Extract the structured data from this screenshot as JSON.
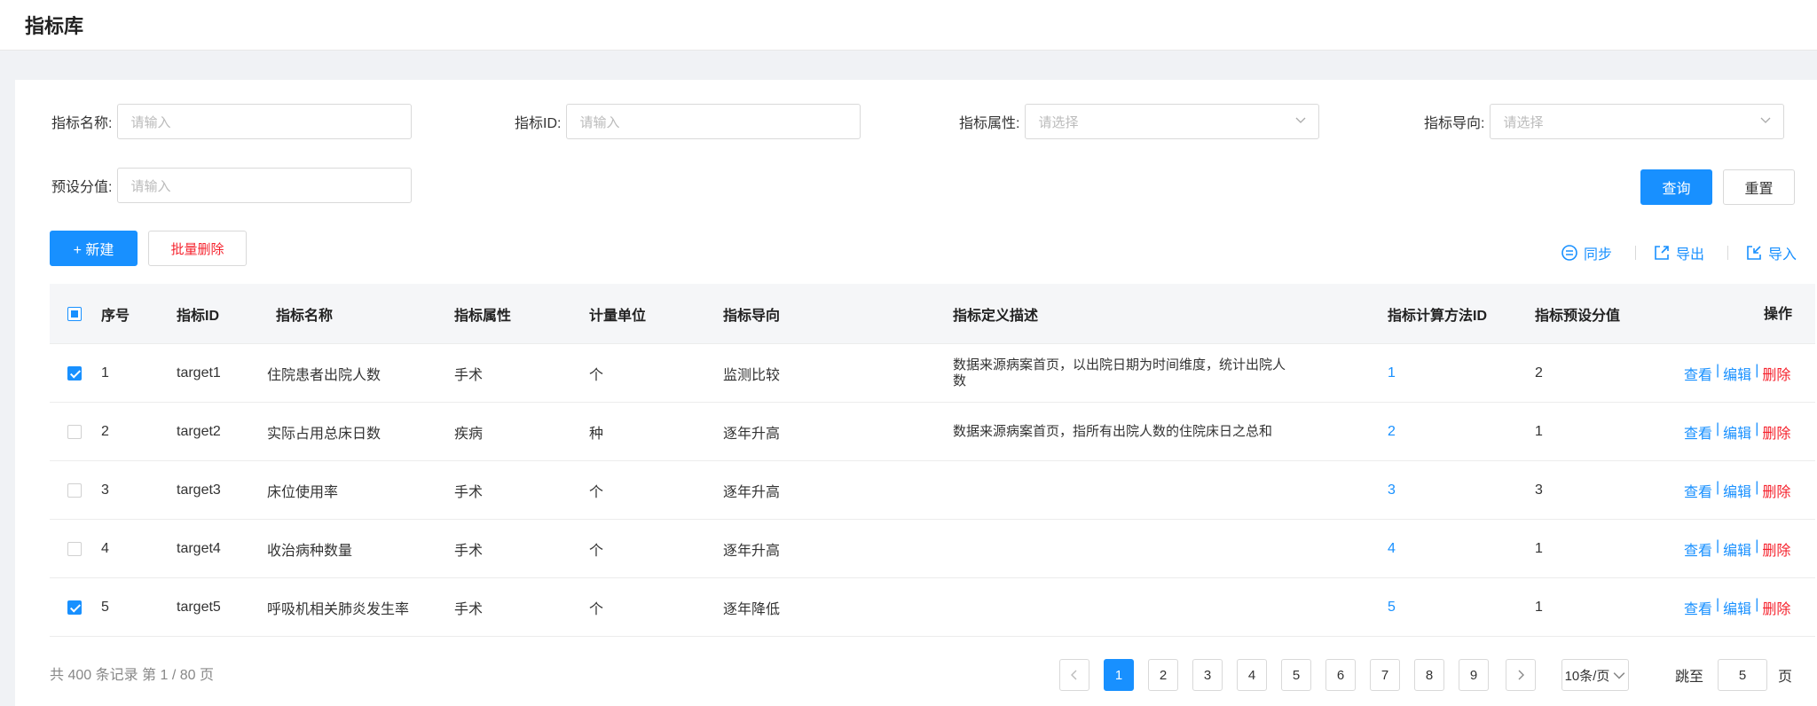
{
  "page_title": "指标库",
  "filters": {
    "name_label": "指标名称:",
    "name_placeholder": "请输入",
    "id_label": "指标ID:",
    "id_placeholder": "请输入",
    "attr_label": "指标属性:",
    "attr_placeholder": "请选择",
    "direction_label": "指标导向:",
    "direction_placeholder": "请选择",
    "preset_label": "预设分值:",
    "preset_placeholder": "请输入",
    "query_label": "查询",
    "reset_label": "重置"
  },
  "toolbar": {
    "new_label": "+ 新建",
    "batch_delete_label": "批量删除",
    "sync_label": "同步",
    "export_label": "导出",
    "import_label": "导入"
  },
  "table": {
    "columns": [
      "序号",
      "指标ID",
      "指标名称",
      "指标属性",
      "计量单位",
      "指标导向",
      "指标定义描述",
      "指标计算方法ID",
      "指标预设分值",
      "操作"
    ],
    "header_checkbox": "partial",
    "rows": [
      {
        "checked": true,
        "no": "1",
        "id": "target1",
        "name": "住院患者出院人数",
        "attr": "手术",
        "unit": "个",
        "direction": "监测比较",
        "desc": "数据来源病案首页，以出院日期为时间维度，统计出院人数",
        "method_id": "1",
        "preset": "2"
      },
      {
        "checked": false,
        "no": "2",
        "id": "target2",
        "name": "实际占用总床日数",
        "attr": "疾病",
        "unit": "种",
        "direction": "逐年升高",
        "desc": "数据来源病案首页，指所有出院人数的住院床日之总和",
        "method_id": "2",
        "preset": "1"
      },
      {
        "checked": false,
        "no": "3",
        "id": "target3",
        "name": "床位使用率",
        "attr": "手术",
        "unit": "个",
        "direction": "逐年升高",
        "desc": "",
        "method_id": "3",
        "preset": "3"
      },
      {
        "checked": false,
        "no": "4",
        "id": "target4",
        "name": "收治病种数量",
        "attr": "手术",
        "unit": "个",
        "direction": "逐年升高",
        "desc": "",
        "method_id": "4",
        "preset": "1"
      },
      {
        "checked": true,
        "no": "5",
        "id": "target5",
        "name": "呼吸机相关肺炎发生率",
        "attr": "手术",
        "unit": "个",
        "direction": "逐年降低",
        "desc": "",
        "method_id": "5",
        "preset": "1"
      }
    ],
    "actions": {
      "view": "查看",
      "edit": "编辑",
      "delete": "删除",
      "separator": "|"
    }
  },
  "pagination": {
    "summary": "共 400 条记录 第 1 / 80 页",
    "pages": [
      "1",
      "2",
      "3",
      "4",
      "5",
      "6",
      "7",
      "8",
      "9"
    ],
    "current": "1",
    "page_size": "10条/页",
    "jump_label": "跳至",
    "jump_value": "5",
    "page_suffix": "页"
  },
  "colors": {
    "accent": "#1890ff",
    "danger": "#f5222d"
  }
}
